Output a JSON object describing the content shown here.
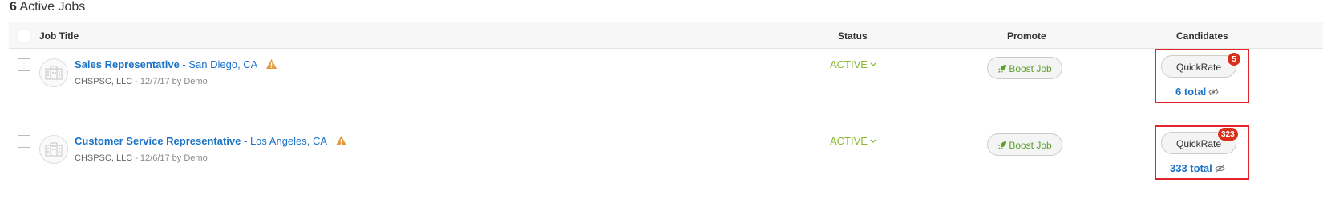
{
  "header": {
    "count": "6",
    "label": "Active Jobs"
  },
  "table": {
    "columns": {
      "job_title": "Job Title",
      "status": "Status",
      "promote": "Promote",
      "candidates": "Candidates"
    }
  },
  "jobs": [
    {
      "title": "Sales Representative",
      "location": "- San Diego, CA",
      "company": "CHSPSC, LLC",
      "meta": "- 12/7/17 by Demo",
      "status": "ACTIVE",
      "boost_label": "Boost Job",
      "quickrate_label": "QuickRate",
      "badge": "5",
      "total": "6 total"
    },
    {
      "title": "Customer Service Representative",
      "location": "- Los Angeles, CA",
      "company": "CHSPSC, LLC",
      "meta": "- 12/6/17 by Demo",
      "status": "ACTIVE",
      "boost_label": "Boost Job",
      "quickrate_label": "QuickRate",
      "badge": "323",
      "total": "333 total"
    }
  ],
  "colors": {
    "link": "#1a73c8",
    "active": "#8ab82e",
    "badge": "#d9301c",
    "highlight": "#e2232b",
    "warning": "#e29a3c"
  },
  "icons": [
    "building-icon",
    "warning-icon",
    "chevron-down-icon",
    "rocket-icon",
    "eye-slash-icon"
  ]
}
